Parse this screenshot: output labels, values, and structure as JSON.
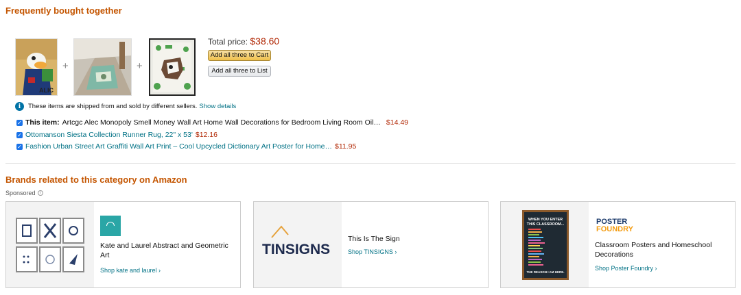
{
  "fbt": {
    "title": "Frequently bought together",
    "total_label": "Total price:",
    "total_price": "$38.60",
    "add_cart_label": "Add all three to Cart",
    "add_list_label": "Add all three to List",
    "plus_sign": "+",
    "info_text": "These items are shipped from and sold by different sellers.",
    "info_link": "Show details",
    "info_icon": "i",
    "items": [
      {
        "prefix": "This item:",
        "title": "Artcgc Alec Monopoly Smell Money Wall Art Home Wall Decorations for Bedroom Living Room Oil…",
        "price": "$14.49"
      },
      {
        "prefix": "",
        "title": "Ottomanson Siesta Collection Runner Rug, 22\" x 53'",
        "price": "$12.16"
      },
      {
        "prefix": "",
        "title": "Fashion Urban Street Art Graffiti Wall Art Print – Cool Upcycled Dictionary Art Poster for Home…",
        "price": "$11.95"
      }
    ]
  },
  "brands": {
    "title": "Brands related to this category on Amazon",
    "sponsored": "Sponsored",
    "sponsored_icon": "i",
    "cards": [
      {
        "name": "Kate and Laurel Abstract and Geometric Art",
        "link": "Shop kate and laurel ›"
      },
      {
        "name": "This Is The Sign",
        "link": "Shop TINSIGNS ›",
        "logo": "TINSIGNS"
      },
      {
        "name": "Classroom Posters and Homeschool Decorations",
        "link": "Shop Poster Foundry ›",
        "logo_line1": "POSTER",
        "logo_line2": "FOUNDRY",
        "poster_heading": "WHEN YOU ENTER THIS CLASSROOM...",
        "poster_footer": "THE REASON I AM HERE."
      }
    ]
  },
  "colors": {
    "section_title": "#c45500",
    "price": "#b12704",
    "link": "#007185",
    "cart_button": "#f0c14b"
  }
}
